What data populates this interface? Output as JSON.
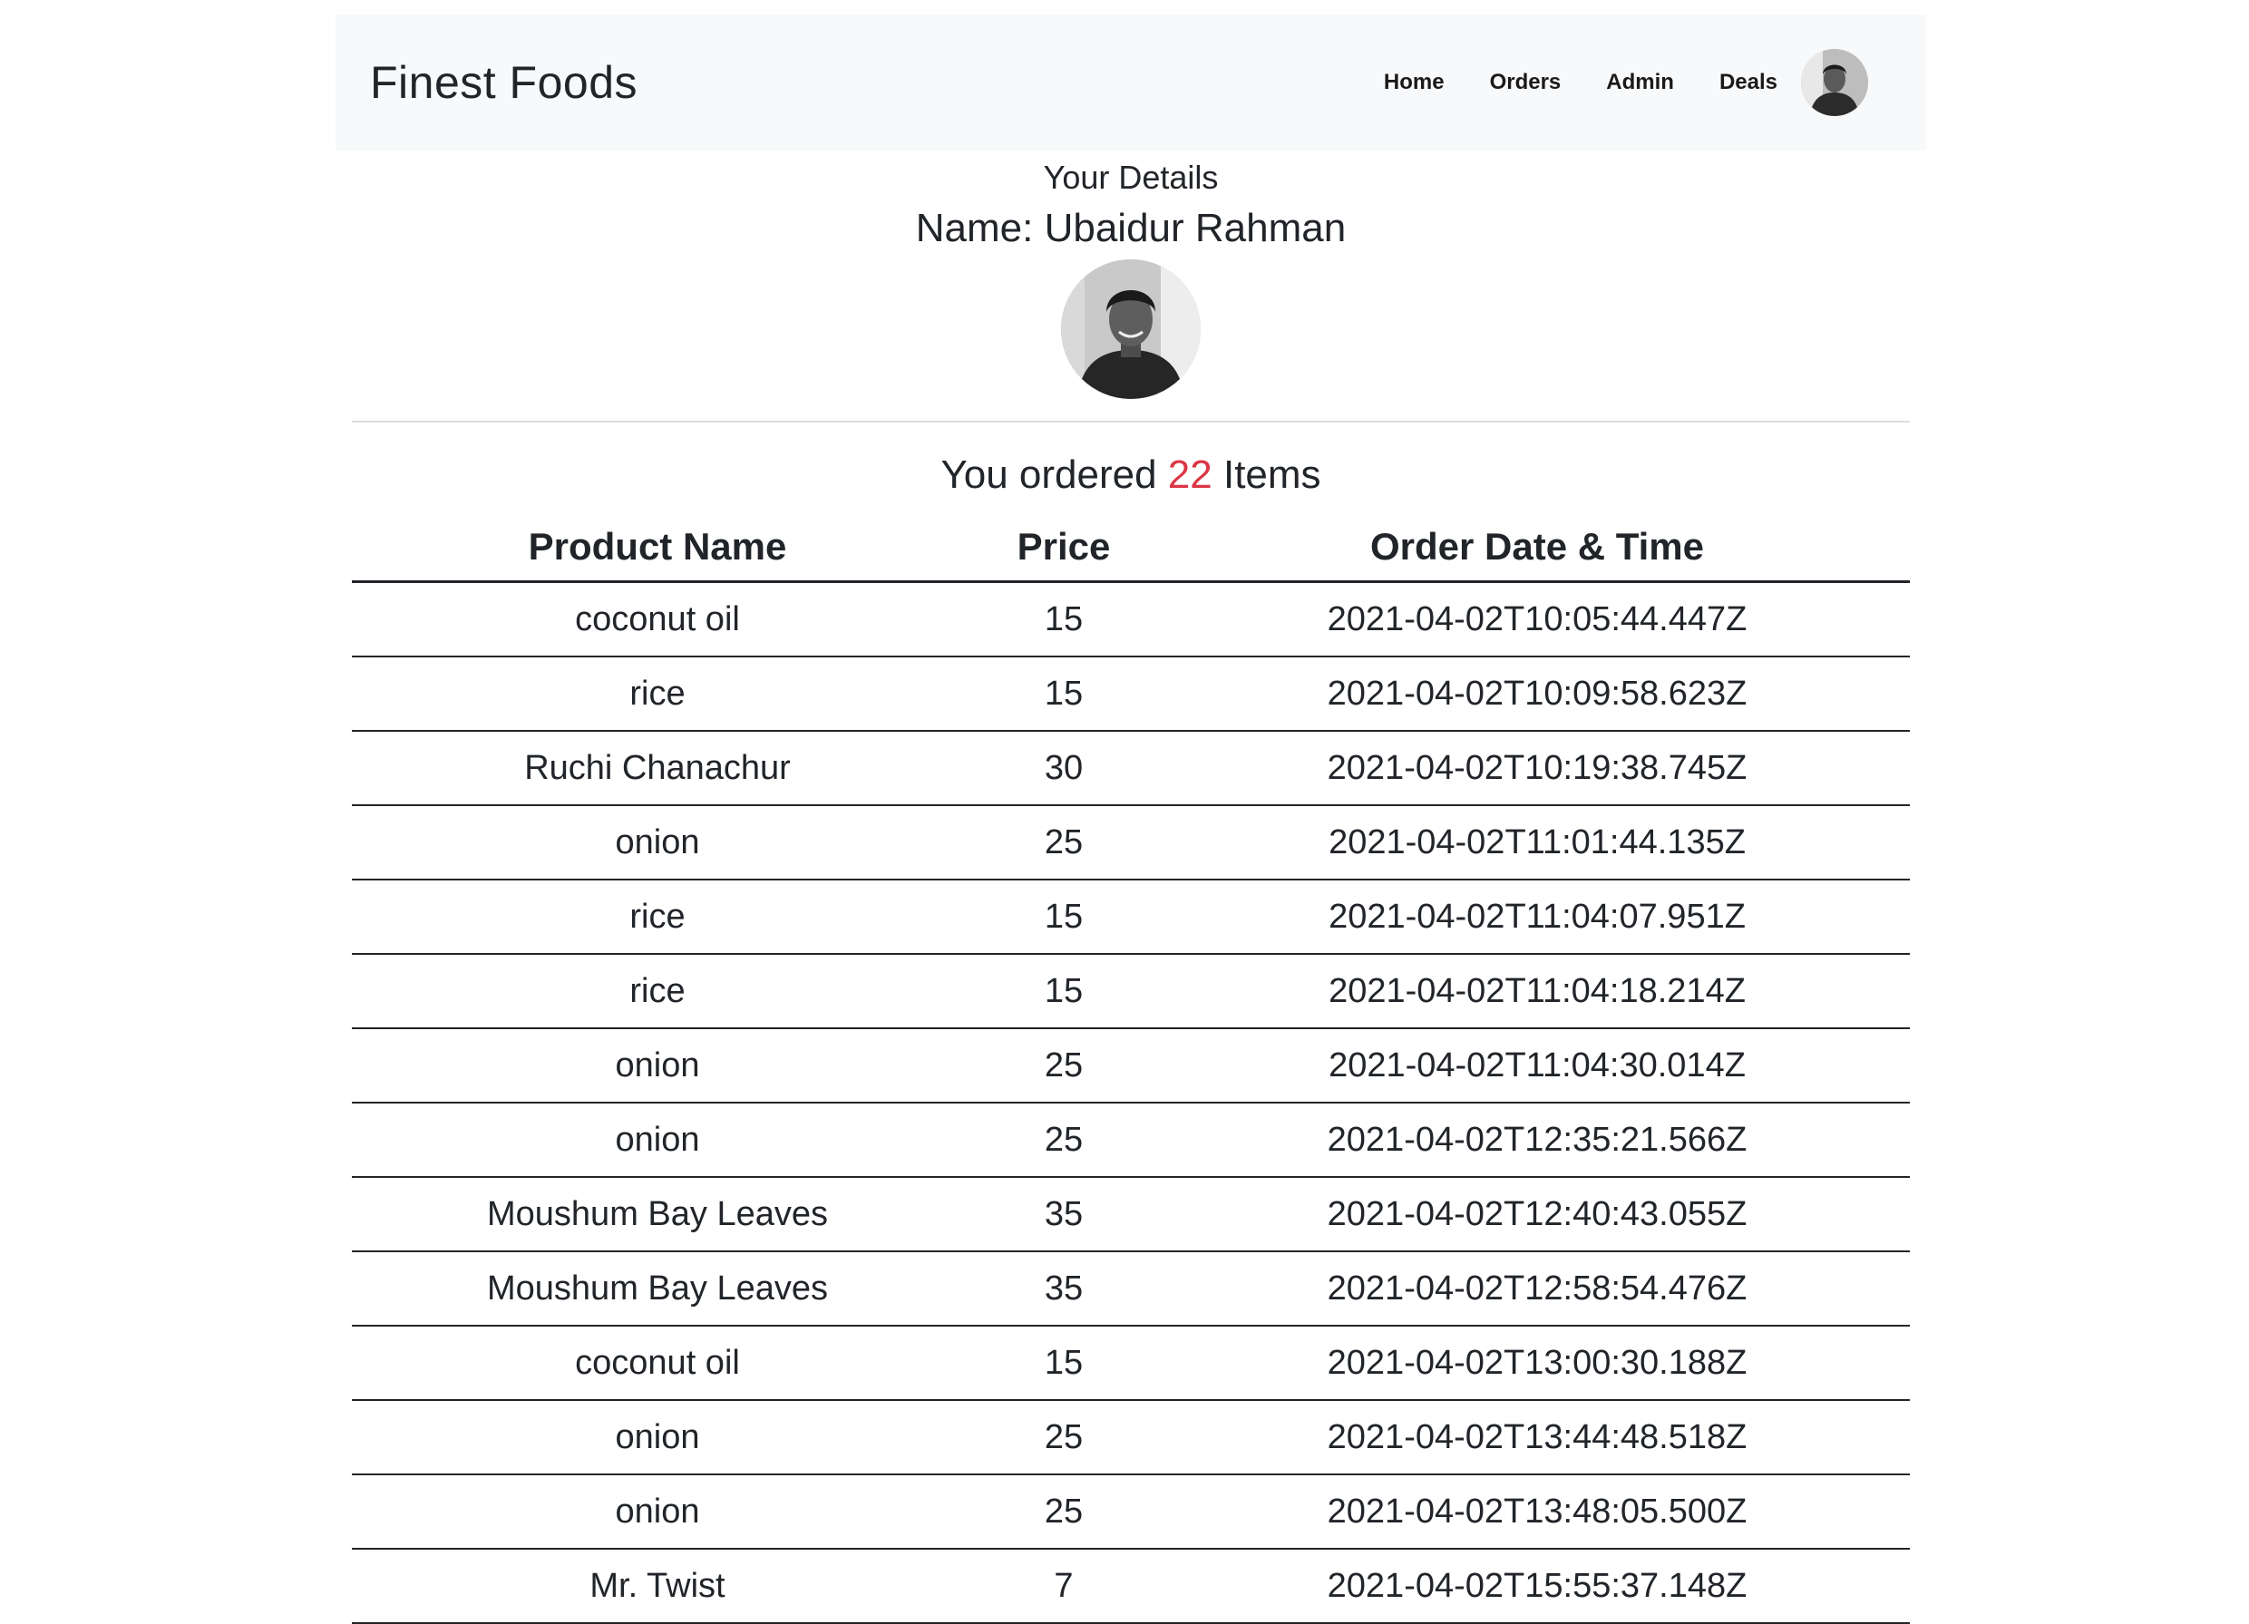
{
  "navbar": {
    "brand": "Finest Foods",
    "links": [
      "Home",
      "Orders",
      "Admin",
      "Deals"
    ]
  },
  "details": {
    "heading": "Your Details",
    "name": "Name: Ubaidur Rahman"
  },
  "summary": {
    "prefix": "You ordered ",
    "count": "22",
    "suffix": " Items"
  },
  "table": {
    "headers": [
      "Product Name",
      "Price",
      "Order Date & Time"
    ],
    "rows": [
      {
        "name": "coconut oil",
        "price": "15",
        "date": "2021-04-02T10:05:44.447Z"
      },
      {
        "name": "rice",
        "price": "15",
        "date": "2021-04-02T10:09:58.623Z"
      },
      {
        "name": "Ruchi Chanachur",
        "price": "30",
        "date": "2021-04-02T10:19:38.745Z"
      },
      {
        "name": "onion",
        "price": "25",
        "date": "2021-04-02T11:01:44.135Z"
      },
      {
        "name": "rice",
        "price": "15",
        "date": "2021-04-02T11:04:07.951Z"
      },
      {
        "name": "rice",
        "price": "15",
        "date": "2021-04-02T11:04:18.214Z"
      },
      {
        "name": "onion",
        "price": "25",
        "date": "2021-04-02T11:04:30.014Z"
      },
      {
        "name": "onion",
        "price": "25",
        "date": "2021-04-02T12:35:21.566Z"
      },
      {
        "name": "Moushum Bay Leaves",
        "price": "35",
        "date": "2021-04-02T12:40:43.055Z"
      },
      {
        "name": "Moushum Bay Leaves",
        "price": "35",
        "date": "2021-04-02T12:58:54.476Z"
      },
      {
        "name": "coconut oil",
        "price": "15",
        "date": "2021-04-02T13:00:30.188Z"
      },
      {
        "name": "onion",
        "price": "25",
        "date": "2021-04-02T13:44:48.518Z"
      },
      {
        "name": "onion",
        "price": "25",
        "date": "2021-04-02T13:48:05.500Z"
      },
      {
        "name": "Mr. Twist",
        "price": "7",
        "date": "2021-04-02T15:55:37.148Z"
      }
    ]
  },
  "colors": {
    "navbar_bg": "#f8f9fa",
    "accent_count": "#dc3545",
    "text": "#212529"
  }
}
